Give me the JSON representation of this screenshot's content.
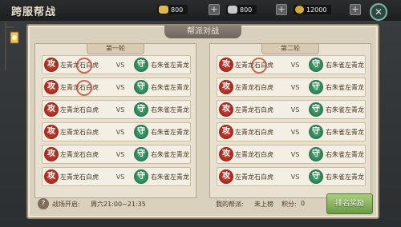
{
  "window": {
    "title": "跨服帮战"
  },
  "resources": [
    {
      "icon": "gold-ingot-icon",
      "value": "800"
    },
    {
      "icon": "silver-ingot-icon",
      "value": "800"
    },
    {
      "icon": "coin-icon",
      "value": "12000"
    }
  ],
  "panel": {
    "header": "帮派对战"
  },
  "rounds": [
    {
      "title": "第一轮",
      "matches": [
        {
          "attack_icon": "攻",
          "left": "左青龙石白虎",
          "vs": "VS",
          "defend_icon": "守",
          "right": "右朱雀左青龙",
          "sealed": true
        },
        {
          "attack_icon": "攻",
          "left": "左青龙石白虎",
          "vs": "VS",
          "defend_icon": "守",
          "right": "右朱雀左青龙",
          "sealed": true
        },
        {
          "attack_icon": "攻",
          "left": "左青龙石白虎",
          "vs": "VS",
          "defend_icon": "守",
          "right": "右朱雀左青龙",
          "sealed": false
        },
        {
          "attack_icon": "攻",
          "left": "左青龙石白虎",
          "vs": "VS",
          "defend_icon": "守",
          "right": "右朱雀左青龙",
          "sealed": false
        },
        {
          "attack_icon": "攻",
          "left": "左青龙石白虎",
          "vs": "VS",
          "defend_icon": "守",
          "right": "右朱雀左青龙",
          "sealed": false
        },
        {
          "attack_icon": "攻",
          "left": "左青龙石白虎",
          "vs": "VS",
          "defend_icon": "守",
          "right": "右朱雀左青龙",
          "sealed": false
        }
      ]
    },
    {
      "title": "第二轮",
      "matches": [
        {
          "attack_icon": "攻",
          "left": "左青龙石白虎",
          "vs": "VS",
          "defend_icon": "守",
          "right": "右朱雀左青龙",
          "sealed": true
        },
        {
          "attack_icon": "攻",
          "left": "左青龙石白虎",
          "vs": "VS",
          "defend_icon": "守",
          "right": "右朱雀左青龙",
          "sealed": false
        },
        {
          "attack_icon": "攻",
          "left": "左青龙石白虎",
          "vs": "VS",
          "defend_icon": "守",
          "right": "右朱雀左青龙",
          "sealed": false
        },
        {
          "attack_icon": "攻",
          "left": "左青龙石白虎",
          "vs": "VS",
          "defend_icon": "守",
          "right": "右朱雀左青龙",
          "sealed": false
        },
        {
          "attack_icon": "攻",
          "left": "左青龙石白虎",
          "vs": "VS",
          "defend_icon": "守",
          "right": "右朱雀左青龙",
          "sealed": false
        },
        {
          "attack_icon": "攻",
          "left": "左青龙石白虎",
          "vs": "VS",
          "defend_icon": "守",
          "right": "右朱雀左青龙",
          "sealed": false
        }
      ]
    }
  ],
  "footer": {
    "help_icon": "?",
    "open_label": "战场开启:",
    "open_time": "周六21:00~21:35",
    "my_guild_label": "我的帮派:",
    "my_guild_value": "未上榜",
    "score_label": "积分:",
    "score_value": "0",
    "rank_reward_button": "排名奖励"
  },
  "colors": {
    "attack": "#c23a2c",
    "defend": "#3f9a6a",
    "button": "#8bb45f"
  }
}
